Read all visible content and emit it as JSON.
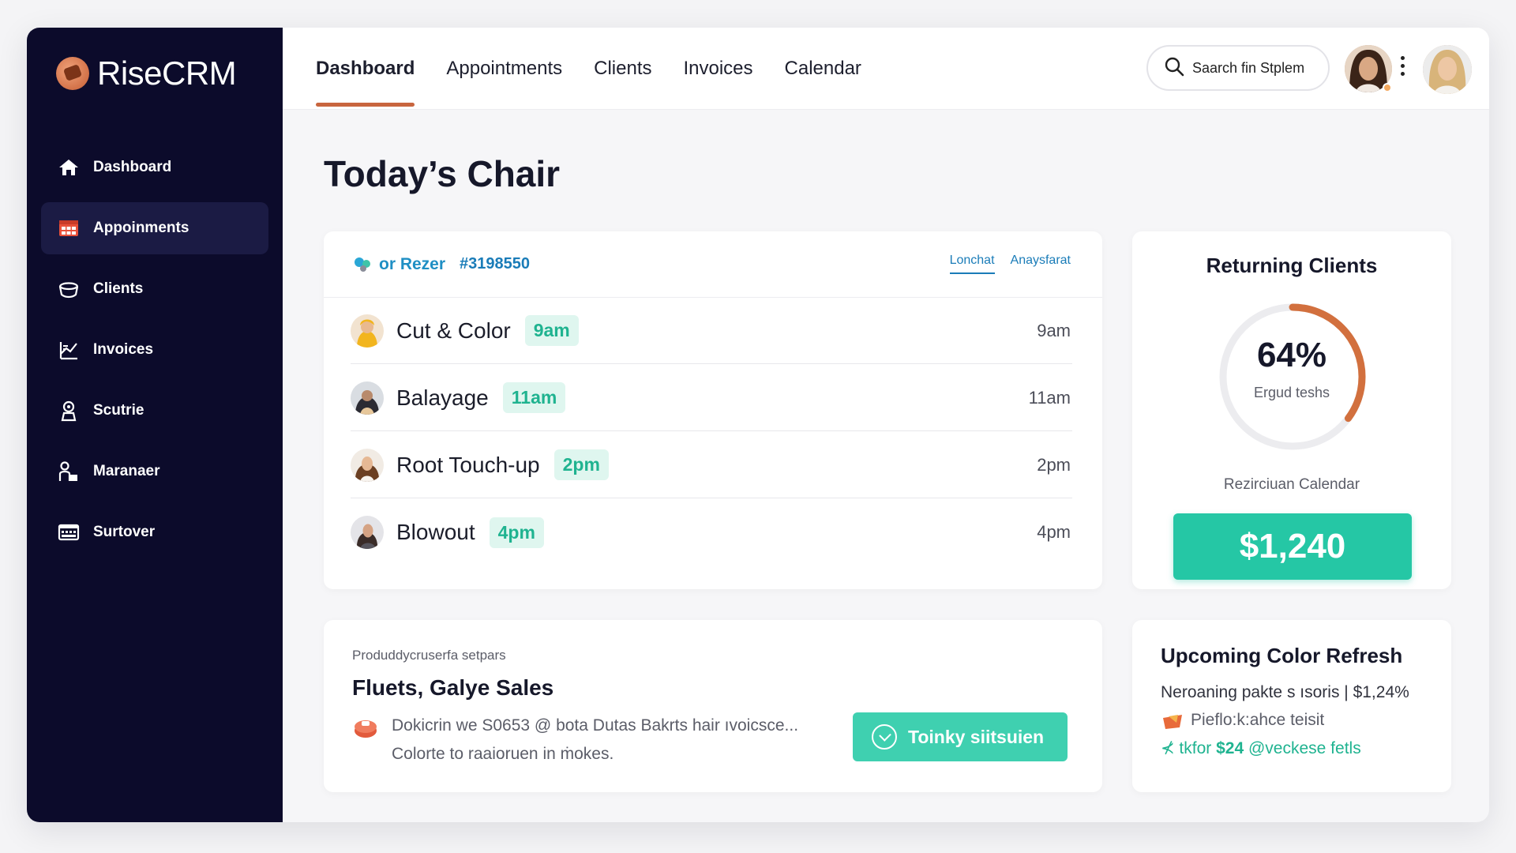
{
  "app": {
    "name": "RiseCRM"
  },
  "sidebar": {
    "items": [
      {
        "label": "Dashboard",
        "icon": "home-icon",
        "active": false
      },
      {
        "label": "Appoinments",
        "icon": "calendar-grid-icon",
        "active": true
      },
      {
        "label": "Clients",
        "icon": "clients-icon",
        "active": false
      },
      {
        "label": "Invoices",
        "icon": "invoices-icon",
        "active": false
      },
      {
        "label": "Scutrie",
        "icon": "badge-icon",
        "active": false
      },
      {
        "label": "Maranaer",
        "icon": "manager-icon",
        "active": false
      },
      {
        "label": "Surtover",
        "icon": "keyboard-icon",
        "active": false
      }
    ]
  },
  "header": {
    "tabs": [
      "Dashboard",
      "Appointments",
      "Clients",
      "Invoices",
      "Calendar"
    ],
    "active_tab": "Dashboard",
    "search_placeholder": "Saarch fin Stplem"
  },
  "page": {
    "title": "Today’s Chair"
  },
  "chair": {
    "stylist": "or Rezer",
    "stylist_id": "#3198550",
    "links": [
      "Lonchat",
      "Anaysfarat"
    ],
    "appointments": [
      {
        "service": "Cut & Color",
        "badge": "9am",
        "time": "9am"
      },
      {
        "service": "Balayage",
        "badge": "11am",
        "time": "11am"
      },
      {
        "service": "Root Touch-up",
        "badge": "2pm",
        "time": "2pm"
      },
      {
        "service": "Blowout",
        "badge": "4pm",
        "time": "4pm"
      }
    ]
  },
  "returning": {
    "title": "Returning Clients",
    "percent": "64%",
    "percent_value": 0.64,
    "subtitle": "Ergud teshs",
    "calendar_label": "Rezirciuan Calendar",
    "amount": "$1,240"
  },
  "sales": {
    "kicker": "Produddycruserfa setpars",
    "title": "Fluets, Galye Sales",
    "line1": "Dokicrin we S0653 @ bota Dutas Bakrts hair ıvoicsce...",
    "line2": "Colorte to raaioruen in ṁokes.",
    "button": "Toinky siitsuien"
  },
  "upcoming": {
    "title": "Upcoming Color Refresh",
    "line1": "Neroaning pakte s ısoris  |  $1,24%",
    "line2": "Pieflo:k:ahce teisit",
    "line3_prefix": "⊀ tkfor ",
    "line3_amount": "$24",
    "line3_suffix": " @veckese fetls"
  },
  "colors": {
    "accent": "#c8653e",
    "teal": "#25c7a5",
    "sidebar": "#0c0b2b"
  }
}
